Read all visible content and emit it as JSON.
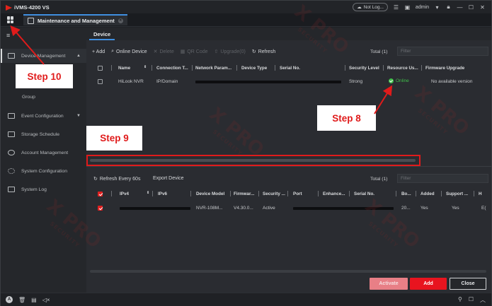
{
  "app": {
    "title": "iVMS-4200 VS"
  },
  "titlebar": {
    "not_logged": "Not Log...",
    "user": "admin"
  },
  "module_tab": {
    "label": "Maintenance and Management"
  },
  "sidebar": {
    "items": [
      {
        "label": "Device Management",
        "icon": "device-icon"
      },
      {
        "label": "Group",
        "icon": ""
      },
      {
        "label": "Event Configuration",
        "icon": "event-icon"
      },
      {
        "label": "Storage Schedule",
        "icon": "storage-icon"
      },
      {
        "label": "Account Management",
        "icon": "account-icon"
      },
      {
        "label": "System Configuration",
        "icon": "gear-icon"
      },
      {
        "label": "System Log",
        "icon": "log-icon"
      }
    ]
  },
  "device_tab": {
    "label": "Device"
  },
  "toolbar": {
    "add": "+ Add",
    "online_device": "Online Device",
    "delete": "Delete",
    "qr_code": "QR Code",
    "upgrade": "Upgrade(0)",
    "refresh": "Refresh",
    "total": "Total (1)",
    "filter_placeholder": "Filter"
  },
  "device_table": {
    "headers": [
      "Name",
      "Connection T...",
      "Network Param...",
      "Device Type",
      "Serial No.",
      "Security Level",
      "Resource Us...",
      "Firmware Upgrade"
    ],
    "rows": [
      {
        "name": "HiLook NVR",
        "connection": "IP/Domain",
        "security": "Strong",
        "resource": "Online",
        "firmware": "No available version"
      }
    ]
  },
  "lower_toolbar": {
    "refresh_every": "Refresh Every 60s",
    "export": "Export Device",
    "total": "Total (1)",
    "filter_placeholder": "Filter"
  },
  "online_table": {
    "headers": [
      "IPv4",
      "IPv6",
      "Device Model",
      "Firmwar...",
      "Security ...",
      "Port",
      "Enhance...",
      "Serial No.",
      "Bo...",
      "Added",
      "Support ...",
      "H"
    ],
    "rows": [
      {
        "model": "NVR-108M...",
        "firmware": "V4.30.0...",
        "security": "Active",
        "bo": "20...",
        "added": "Yes",
        "support": "Yes",
        "h": "E("
      }
    ]
  },
  "buttons": {
    "activate": "Activate",
    "add": "Add",
    "close": "Close"
  },
  "annotations": {
    "step10": "Step 10",
    "step9": "Step 9",
    "step8": "Step 8"
  },
  "watermark": {
    "text": "X PRO",
    "sub": "SECURITY"
  },
  "colors": {
    "accent": "#e8141f",
    "online": "#3fbf4a",
    "annotation": "#e01b1b"
  }
}
